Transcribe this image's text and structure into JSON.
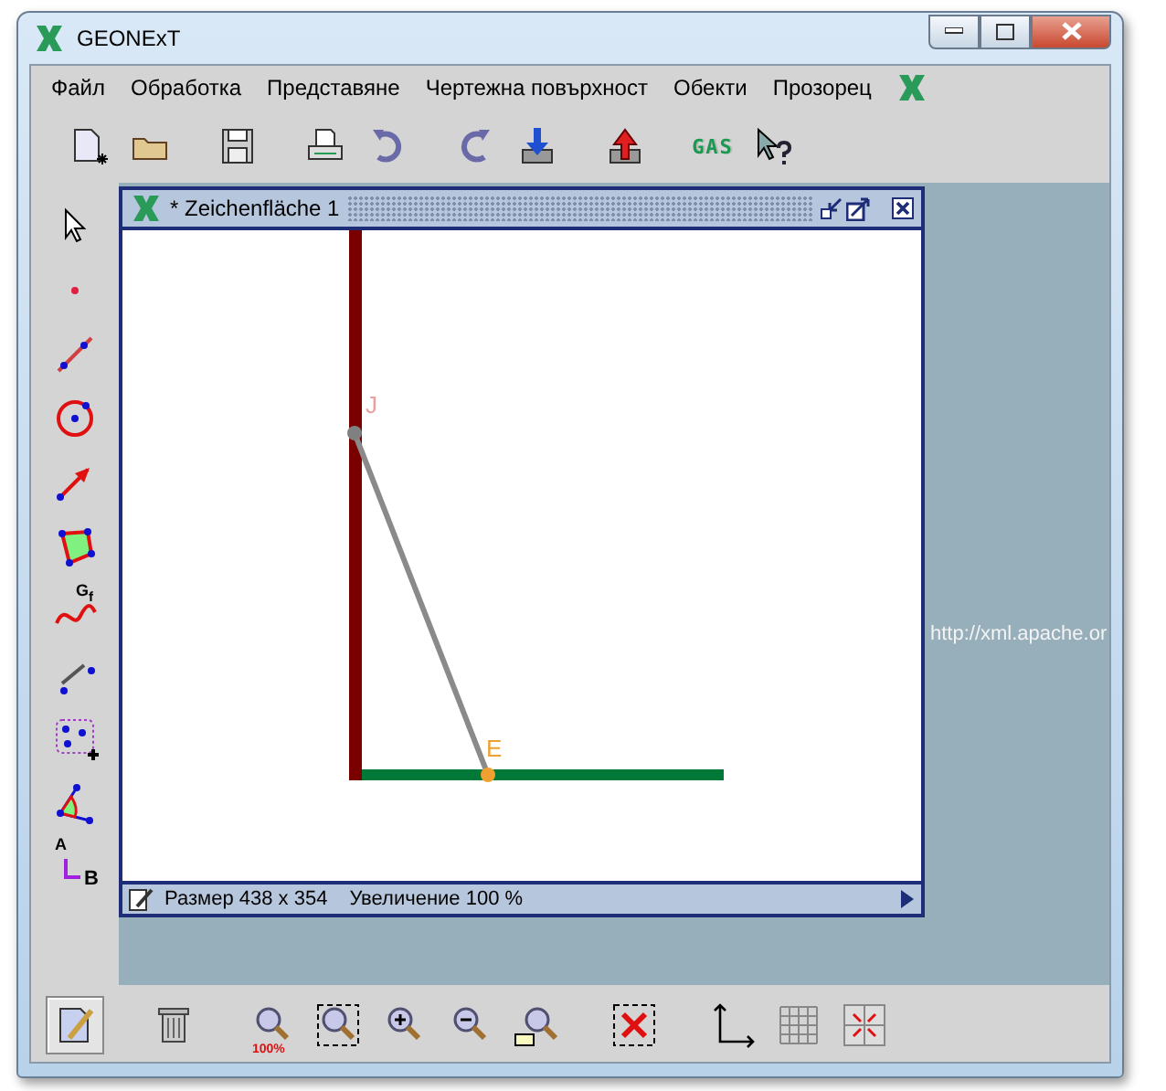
{
  "window": {
    "title": "GEONExT"
  },
  "menu": [
    {
      "label": "Файл"
    },
    {
      "label": "Обработка"
    },
    {
      "label": "Представяне"
    },
    {
      "label": "Чертежна повърхност"
    },
    {
      "label": "Обекти"
    },
    {
      "label": "Прозорец"
    }
  ],
  "toolbar": {
    "gas_label": "GAS"
  },
  "tools": [
    {
      "kind": "pointer"
    },
    {
      "kind": "point"
    },
    {
      "kind": "segment"
    },
    {
      "kind": "circle"
    },
    {
      "kind": "vector"
    },
    {
      "kind": "polygon"
    },
    {
      "kind": "function",
      "label": "G$_{f}$"
    },
    {
      "kind": "measure"
    },
    {
      "kind": "group"
    },
    {
      "kind": "angle"
    },
    {
      "kind": "text",
      "label_top": "A",
      "label_bottom": "B"
    }
  ],
  "drawing_window": {
    "title": "* Zeichenfläche 1",
    "status_size": "Размер 438 x 354",
    "status_zoom": "Увеличение 100 %",
    "points": [
      {
        "label": "J",
        "color": "#808080"
      },
      {
        "label": "E",
        "color": "#f0a030"
      }
    ]
  },
  "desktop_text": "http://xml.apache.or",
  "bottom_tools": [
    {
      "kind": "edit",
      "selected": true
    },
    {
      "kind": "trash",
      "selected": false
    },
    {
      "kind": "zoom100",
      "label": "100%",
      "selected": false
    },
    {
      "kind": "zoomfit",
      "selected": false
    },
    {
      "kind": "zoomin",
      "selected": false
    },
    {
      "kind": "zoomout",
      "selected": false
    },
    {
      "kind": "zoomrect",
      "selected": false
    },
    {
      "kind": "delete",
      "selected": false
    },
    {
      "kind": "axes",
      "selected": false
    },
    {
      "kind": "grid",
      "selected": false
    },
    {
      "kind": "snap",
      "selected": false
    }
  ]
}
